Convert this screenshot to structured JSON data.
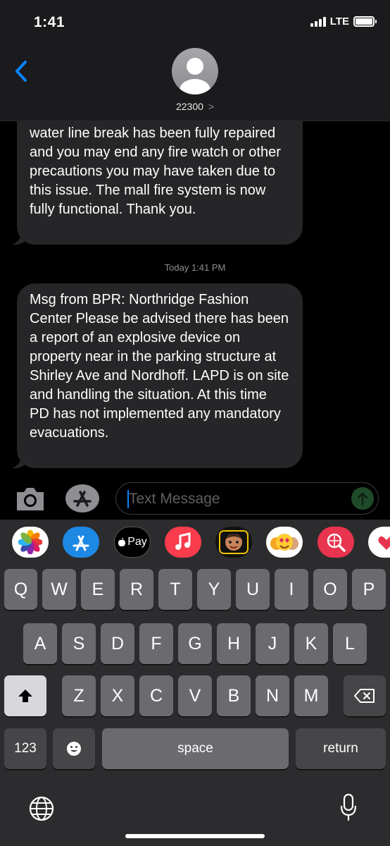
{
  "status_bar": {
    "time": "1:41",
    "network": "LTE"
  },
  "header": {
    "contact_name": "22300",
    "contact_chevron": ">"
  },
  "messages": [
    {
      "text": "water line break has been fully repaired and you may end any fire watch or other precautions you may have taken due to this issue.  The mall fire system is now fully functional.  Thank you."
    },
    {
      "text": "Msg from BPR: Northridge Fashion Center Please be advised there has been a report of an explosive device on property near in the parking structure at Shirley Ave and Nordhoff.  LAPD is on site and handling the situation.  At this time PD has not implemented any mandatory evacuations."
    }
  ],
  "timestamp": "Today 1:41 PM",
  "input": {
    "placeholder": "Text Message"
  },
  "app_strip": [
    {
      "name": "photos-icon"
    },
    {
      "name": "app-store-icon"
    },
    {
      "name": "apple-pay-icon",
      "label": "Pay"
    },
    {
      "name": "music-icon"
    },
    {
      "name": "memoji-icon"
    },
    {
      "name": "animoji-stickers-icon"
    },
    {
      "name": "gif-search-icon"
    },
    {
      "name": "digital-touch-icon"
    }
  ],
  "keyboard": {
    "row1": [
      "Q",
      "W",
      "E",
      "R",
      "T",
      "Y",
      "U",
      "I",
      "O",
      "P"
    ],
    "row2": [
      "A",
      "S",
      "D",
      "F",
      "G",
      "H",
      "J",
      "K",
      "L"
    ],
    "row3": [
      "Z",
      "X",
      "C",
      "V",
      "B",
      "N",
      "M"
    ],
    "numbers_label": "123",
    "space_label": "space",
    "return_label": "return"
  },
  "colors": {
    "bubble": "#262628",
    "accent": "#0a84ff",
    "send": "#1f4a29"
  }
}
